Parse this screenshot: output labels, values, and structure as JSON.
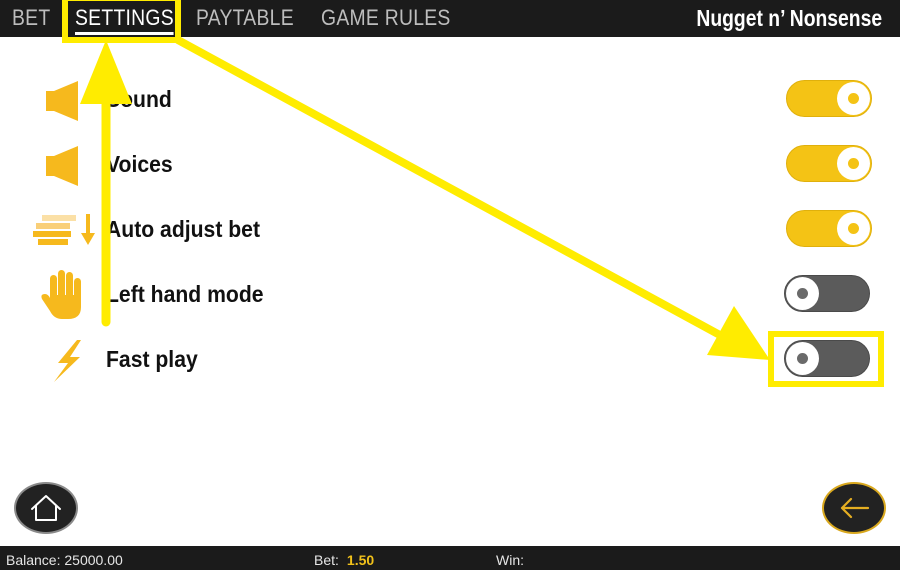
{
  "nav": {
    "tabs": [
      {
        "label": "BET",
        "active": false
      },
      {
        "label": "SETTINGS",
        "active": true
      },
      {
        "label": "PAYTABLE",
        "active": false
      },
      {
        "label": "GAME RULES",
        "active": false
      }
    ],
    "game_title": "Nugget n’ Nonsense"
  },
  "settings": [
    {
      "label": "Sound",
      "icon": "speaker-icon",
      "enabled": true
    },
    {
      "label": "Voices",
      "icon": "speaker-icon",
      "enabled": true
    },
    {
      "label": "Auto adjust bet",
      "icon": "coin-stack-down-arrow-icon",
      "enabled": true
    },
    {
      "label": "Left hand mode",
      "icon": "hand-icon",
      "enabled": false
    },
    {
      "label": "Fast play",
      "icon": "lightning-icon",
      "enabled": false
    }
  ],
  "buttons": {
    "home_icon": "home-icon",
    "back_icon": "arrow-left-icon"
  },
  "status": {
    "balance_label": "Balance:",
    "balance_value": "25000.00",
    "bet_label": "Bet:",
    "bet_value": "1.50",
    "win_label": "Win:",
    "win_value": ""
  },
  "colors": {
    "accent_yellow": "#f4c315",
    "toggle_off": "#5b5b5b",
    "bar_background": "#1b1b1b",
    "annotation_yellow": "#ffec00"
  }
}
